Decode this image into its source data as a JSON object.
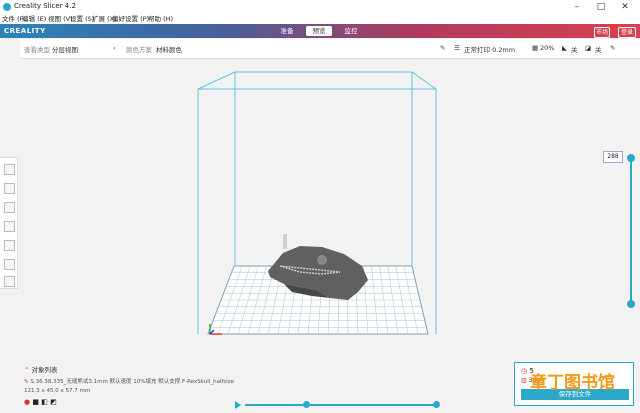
{
  "window": {
    "title": "Creality Slicer 4.2"
  },
  "menu": [
    "文件 (F)",
    "编辑 (E)",
    "视图 (V)",
    "设置 (S)",
    "扩展 (X)",
    "偏好设置 (P)",
    "帮助 (H)"
  ],
  "header": {
    "logo": "CREALITY",
    "tabs": [
      "准备",
      "预览",
      "监控"
    ],
    "active_tab": "预览",
    "buttons": [
      "市场",
      "登录"
    ]
  },
  "options": {
    "view_type_label": "查看类型",
    "view_type_value": "分层视图",
    "color_scheme_label": "颜色方案",
    "color_scheme_value": "材料颜色",
    "profile": "正常打印 0.2mm",
    "infill": "20%",
    "support": "关",
    "adhesion": "关"
  },
  "layer": {
    "current": "288"
  },
  "bottom": {
    "object_list_label": "对象列表",
    "file_name": "S.36.38.335_无缝熊试3.1mm 默认速度 10%填充 默认支撑 F-RexSkull_halfsize",
    "dimensions": "121.3 x 45.0 x 57.7 mm",
    "time_prefix": "5 ",
    "material_prefix": "35g",
    "save_button": "保存到文件"
  },
  "watermark": "章丁图书馆",
  "colors": {
    "accent": "#2aa7c9",
    "header_left": "#2b84b8",
    "header_right": "#d8414f",
    "model": "#555555"
  },
  "icons": [
    "app-icon",
    "minimize-icon",
    "maximize-icon",
    "close-icon",
    "pencil-icon",
    "settings-icon",
    "infill-icon",
    "support-icon",
    "adhesion-icon",
    "play-icon",
    "clock-icon",
    "material-icon"
  ]
}
